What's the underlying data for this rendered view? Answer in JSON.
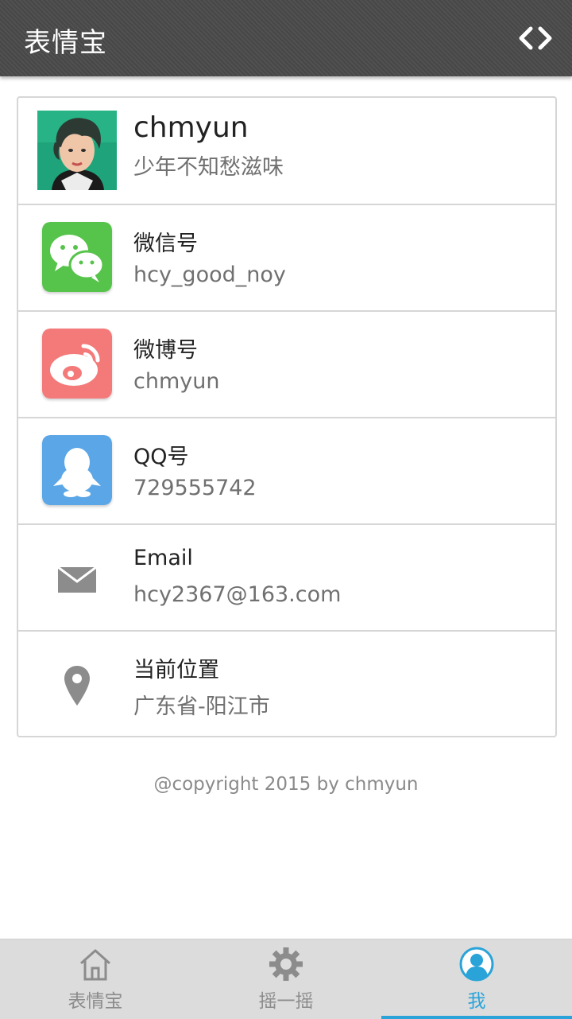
{
  "header": {
    "title": "表情宝",
    "action_icon": "code-icon"
  },
  "profile": {
    "name": "chmyun",
    "signature": "少年不知愁滋味"
  },
  "items": [
    {
      "label": "微信号",
      "value": "hcy_good_noy",
      "icon": "wechat-icon",
      "color": "#56c34a"
    },
    {
      "label": "微博号",
      "value": "chmyun",
      "icon": "weibo-icon",
      "color": "#f47a7a"
    },
    {
      "label": "QQ号",
      "value": "729555742",
      "icon": "qq-icon",
      "color": "#5aa6e6"
    },
    {
      "label": "Email",
      "value": "hcy2367@163.com",
      "icon": "mail-icon",
      "color": "#8c8c8c"
    },
    {
      "label": "当前位置",
      "value": "广东省-阳江市",
      "icon": "location-pin-icon",
      "color": "#8c8c8c"
    }
  ],
  "footer": {
    "copyright": "@copyright 2015 by chmyun"
  },
  "tabs": [
    {
      "label": "表情宝",
      "icon": "home-icon",
      "active": false
    },
    {
      "label": "摇一摇",
      "icon": "gear-icon",
      "active": false
    },
    {
      "label": "我",
      "icon": "user-icon",
      "active": true
    }
  ],
  "colors": {
    "accent": "#2aa3d8",
    "header_bg": "#4a4a4a",
    "tabbar_bg": "#dcdcdc"
  }
}
